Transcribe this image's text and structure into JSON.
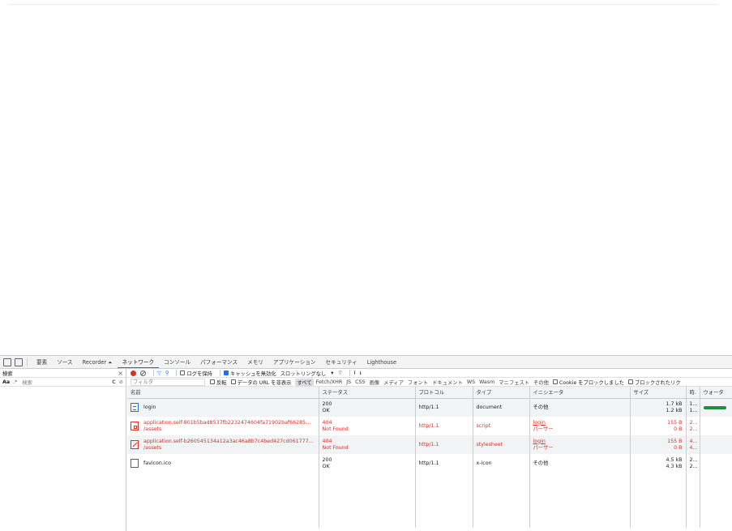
{
  "devtools": {
    "tabs": [
      "要素",
      "ソース",
      "Recorder ⏶",
      "ネットワーク",
      "コンソール",
      "パフォーマンス",
      "メモリ",
      "アプリケーション",
      "セキュリティ",
      "Lighthouse"
    ],
    "active_tab": "ネットワーク"
  },
  "search_panel": {
    "title": "検索",
    "close": "×",
    "match_case": "Aa",
    "regex": ".*",
    "search_placeholder": "検索",
    "refresh": "C",
    "clear": "⊘"
  },
  "network_toolbar": {
    "preserve_log": "ログを保持",
    "disable_cache": "キャッシュを無効化",
    "throttling": "スロットリングなし",
    "dropdown_arrow": "▾",
    "wifi": "⌔",
    "upload": "⭱",
    "download": "⭳"
  },
  "filter_bar": {
    "filter_placeholder": "フィルタ",
    "invert": "反転",
    "hide_data_urls": "データの URL を非表示",
    "types": [
      "すべて",
      "Fetch/XHR",
      "JS",
      "CSS",
      "画像",
      "メディア",
      "フォント",
      "ドキュメント",
      "WS",
      "Wasm",
      "マニフェスト",
      "その他"
    ],
    "blocked_cookies": "Cookie をブロックしました",
    "blocked_requests": "ブロックされたリク"
  },
  "table": {
    "columns": [
      "名前",
      "ステータス",
      "プロトコル",
      "タイプ",
      "イニシエータ",
      "サイズ",
      "時.",
      "ウォータ"
    ],
    "rows": [
      {
        "name": "login",
        "path": "",
        "status": "200",
        "status_text": "OK",
        "protocol": "http/1.1",
        "type": "document",
        "initiator": "その他",
        "initiator_sub": "",
        "size1": "1.7 kB",
        "size2": "1.2 kB",
        "time1": "1...",
        "time2": "1..."
      },
      {
        "name": "application.self-801b5bad8537fb2232474604fa71902baf66285b72...",
        "path": "/assets",
        "status": "404",
        "status_text": "Not Found",
        "protocol": "http/1.1",
        "type": "script",
        "initiator": "login",
        "initiator_sub": "パーサー",
        "size1": "155 B",
        "size2": "0 B",
        "time1": "2...",
        "time2": "2..."
      },
      {
        "name": "application.self-b260545134a12a3ac46a8b7c4bed427cd0617773a...",
        "path": "/assets",
        "status": "404",
        "status_text": "Not Found",
        "protocol": "http/1.1",
        "type": "stylesheet",
        "initiator": "login",
        "initiator_sub": "パーサー",
        "size1": "155 B",
        "size2": "0 B",
        "time1": "4...",
        "time2": "4..."
      },
      {
        "name": "favicon.ico",
        "path": "",
        "status": "200",
        "status_text": "OK",
        "protocol": "http/1.1",
        "type": "x-icon",
        "initiator": "その他",
        "initiator_sub": "",
        "size1": "4.5 kB",
        "size2": "4.3 kB",
        "time1": "2...",
        "time2": "2..."
      }
    ]
  },
  "colors": {
    "accent": "#1a73e8",
    "error": "#d93025",
    "record": "#d93025",
    "waterfall": "#1e8e3e"
  }
}
